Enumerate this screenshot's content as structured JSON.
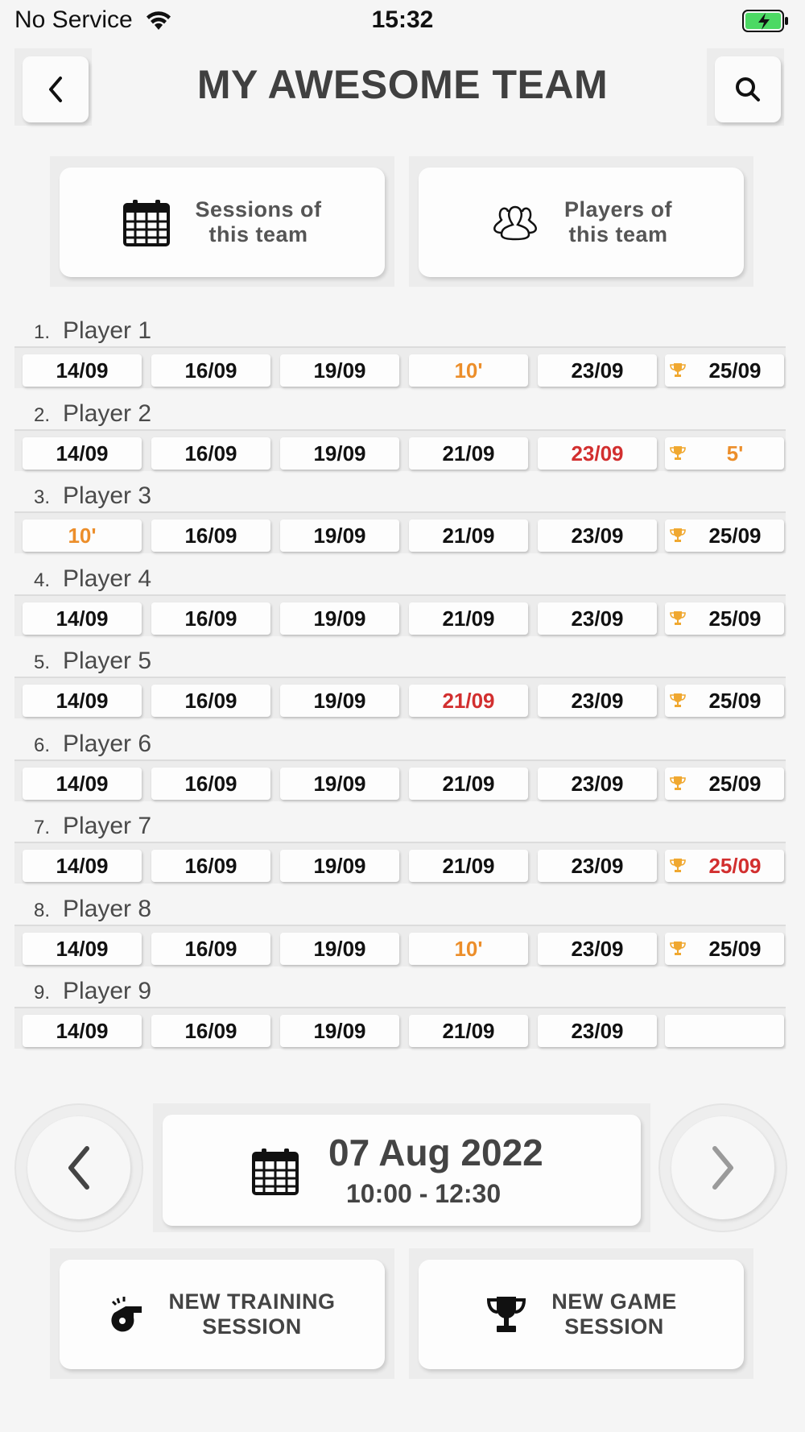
{
  "status_bar": {
    "carrier": "No Service",
    "time": "15:32",
    "battery_color": "#4cd964"
  },
  "header": {
    "title": "MY AWESOME TEAM",
    "back_icon": "chevron-left-icon",
    "search_icon": "search-icon"
  },
  "actions": {
    "sessions": {
      "label_line1": "Sessions of",
      "label_line2": "this team",
      "icon": "calendar-icon"
    },
    "players": {
      "label_line1": "Players of",
      "label_line2": "this team",
      "icon": "users-icon"
    }
  },
  "colors": {
    "orange": "#ec8e2a",
    "red": "#d22f2f",
    "trophy": "#f0a830"
  },
  "players": [
    {
      "num": "1.",
      "name": "Player 1",
      "sessions": [
        {
          "text": "14/09",
          "color": "black"
        },
        {
          "text": "16/09",
          "color": "black"
        },
        {
          "text": "19/09",
          "color": "black"
        },
        {
          "text": "10'",
          "color": "orange"
        },
        {
          "text": "23/09",
          "color": "black"
        },
        {
          "text": "25/09",
          "color": "black",
          "trophy": true
        }
      ]
    },
    {
      "num": "2.",
      "name": "Player 2",
      "sessions": [
        {
          "text": "14/09",
          "color": "black"
        },
        {
          "text": "16/09",
          "color": "black"
        },
        {
          "text": "19/09",
          "color": "black"
        },
        {
          "text": "21/09",
          "color": "black"
        },
        {
          "text": "23/09",
          "color": "red"
        },
        {
          "text": "5'",
          "color": "orange",
          "trophy": true
        }
      ]
    },
    {
      "num": "3.",
      "name": "Player 3",
      "sessions": [
        {
          "text": "10'",
          "color": "orange"
        },
        {
          "text": "16/09",
          "color": "black"
        },
        {
          "text": "19/09",
          "color": "black"
        },
        {
          "text": "21/09",
          "color": "black"
        },
        {
          "text": "23/09",
          "color": "black"
        },
        {
          "text": "25/09",
          "color": "black",
          "trophy": true
        }
      ]
    },
    {
      "num": "4.",
      "name": "Player 4",
      "sessions": [
        {
          "text": "14/09",
          "color": "black"
        },
        {
          "text": "16/09",
          "color": "black"
        },
        {
          "text": "19/09",
          "color": "black"
        },
        {
          "text": "21/09",
          "color": "black"
        },
        {
          "text": "23/09",
          "color": "black"
        },
        {
          "text": "25/09",
          "color": "black",
          "trophy": true
        }
      ]
    },
    {
      "num": "5.",
      "name": "Player 5",
      "sessions": [
        {
          "text": "14/09",
          "color": "black"
        },
        {
          "text": "16/09",
          "color": "black"
        },
        {
          "text": "19/09",
          "color": "black"
        },
        {
          "text": "21/09",
          "color": "red"
        },
        {
          "text": "23/09",
          "color": "black"
        },
        {
          "text": "25/09",
          "color": "black",
          "trophy": true
        }
      ]
    },
    {
      "num": "6.",
      "name": "Player 6",
      "sessions": [
        {
          "text": "14/09",
          "color": "black"
        },
        {
          "text": "16/09",
          "color": "black"
        },
        {
          "text": "19/09",
          "color": "black"
        },
        {
          "text": "21/09",
          "color": "black"
        },
        {
          "text": "23/09",
          "color": "black"
        },
        {
          "text": "25/09",
          "color": "black",
          "trophy": true
        }
      ]
    },
    {
      "num": "7.",
      "name": "Player 7",
      "sessions": [
        {
          "text": "14/09",
          "color": "black"
        },
        {
          "text": "16/09",
          "color": "black"
        },
        {
          "text": "19/09",
          "color": "black"
        },
        {
          "text": "21/09",
          "color": "black"
        },
        {
          "text": "23/09",
          "color": "black"
        },
        {
          "text": "25/09",
          "color": "red",
          "trophy": true
        }
      ]
    },
    {
      "num": "8.",
      "name": "Player 8",
      "sessions": [
        {
          "text": "14/09",
          "color": "black"
        },
        {
          "text": "16/09",
          "color": "black"
        },
        {
          "text": "19/09",
          "color": "black"
        },
        {
          "text": "10'",
          "color": "orange"
        },
        {
          "text": "23/09",
          "color": "black"
        },
        {
          "text": "25/09",
          "color": "black",
          "trophy": true
        }
      ]
    },
    {
      "num": "9.",
      "name": "Player 9",
      "sessions": [
        {
          "text": "14/09",
          "color": "black"
        },
        {
          "text": "16/09",
          "color": "black"
        },
        {
          "text": "19/09",
          "color": "black"
        },
        {
          "text": "21/09",
          "color": "black"
        },
        {
          "text": "23/09",
          "color": "black"
        },
        {
          "text": "",
          "color": "black"
        }
      ]
    }
  ],
  "session_nav": {
    "date": "07 Aug 2022",
    "time": "10:00 - 12:30",
    "prev_icon": "chevron-left-icon",
    "next_icon": "chevron-right-icon"
  },
  "bottom_actions": {
    "training": {
      "label_line1": "NEW TRAINING",
      "label_line2": "SESSION",
      "icon": "whistle-icon"
    },
    "game": {
      "label_line1": "NEW GAME",
      "label_line2": "SESSION",
      "icon": "trophy-icon"
    }
  }
}
